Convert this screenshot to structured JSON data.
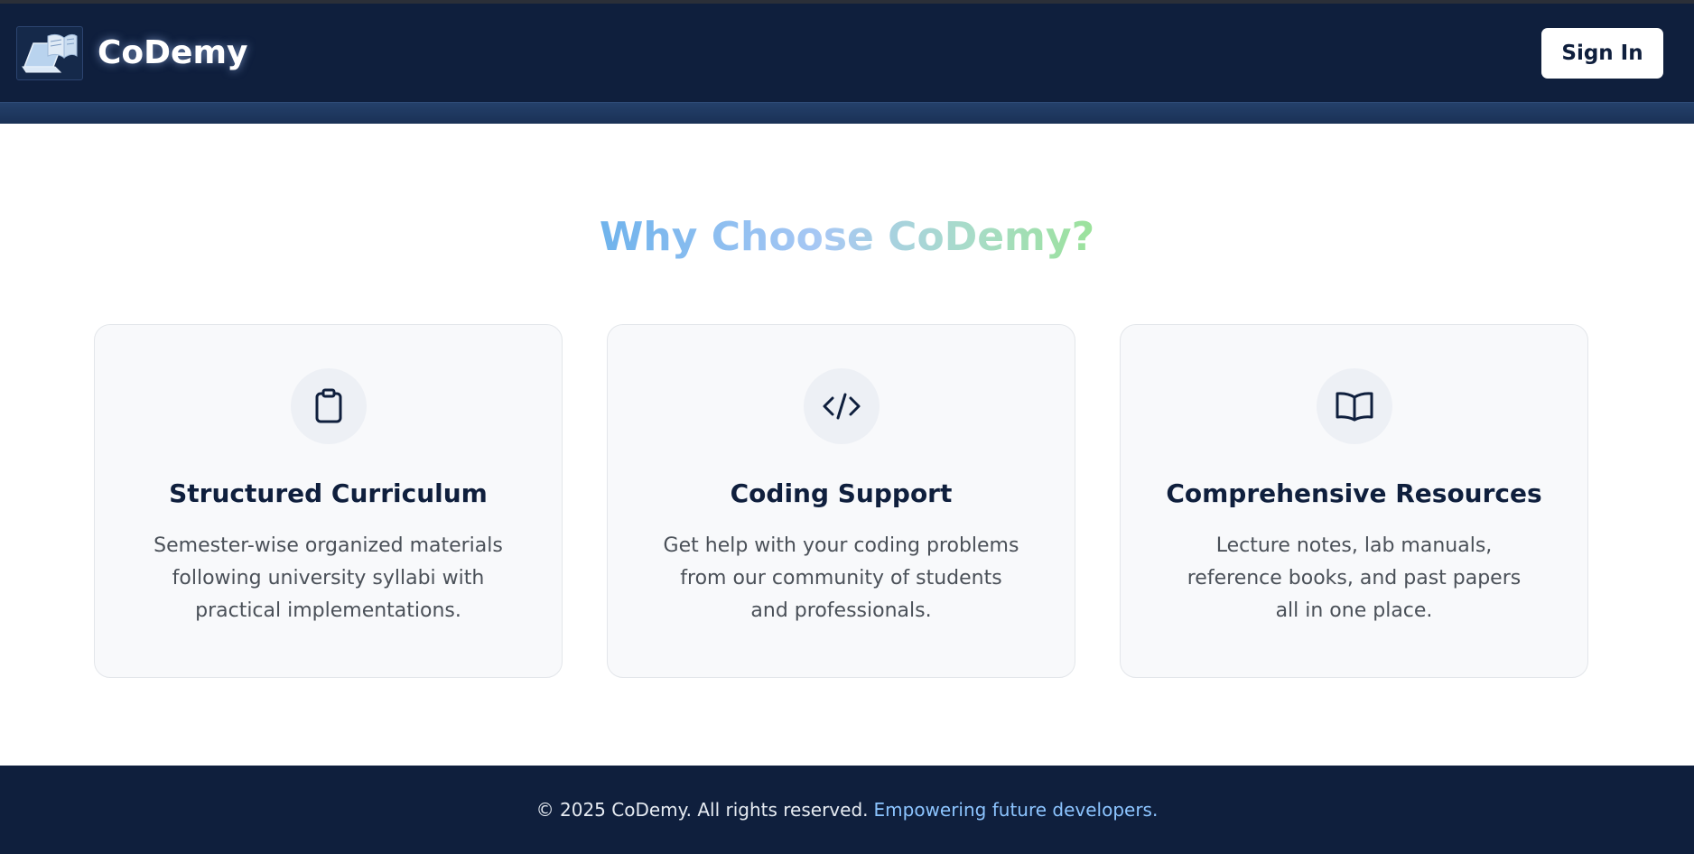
{
  "brand": {
    "name": "CoDemy",
    "logo_icon": "laptop-book-icon"
  },
  "header": {
    "signin_label": "Sign In"
  },
  "section": {
    "title": "Why Choose CoDemy?"
  },
  "features": [
    {
      "icon": "clipboard-icon",
      "title": "Structured Curriculum",
      "description": "Semester-wise organized materials following university syllabi with practical implementations."
    },
    {
      "icon": "code-icon",
      "title": "Coding Support",
      "description": "Get help with your coding problems from our community of students and professionals."
    },
    {
      "icon": "book-open-icon",
      "title": "Comprehensive Resources",
      "description": "Lecture notes, lab manuals, reference books, and past papers all in one place."
    }
  ],
  "footer": {
    "copyright": "© 2025 CoDemy. All rights reserved.",
    "tagline": "Empowering future developers."
  },
  "colors": {
    "navy": "#0f1f3d",
    "card_background": "#f8f9fb",
    "footer_accent": "#8cc4ff",
    "title_gradient_start": "#6fb3ec",
    "title_gradient_end": "#9be29b"
  }
}
